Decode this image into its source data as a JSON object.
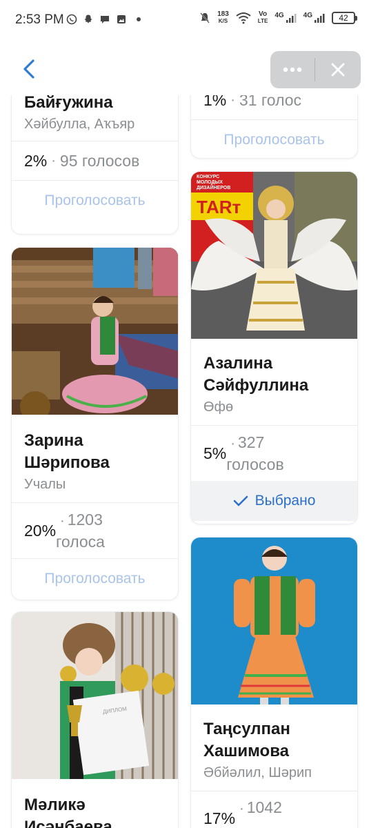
{
  "status": {
    "time": "2:53 PM",
    "net_speed_top": "183",
    "net_speed_bottom": "K/S",
    "volte_top": "Vo",
    "volte_bottom": "LTE",
    "sig1": "4G",
    "sig2": "4G",
    "battery": "42"
  },
  "header": {
    "more_icon": "more-dots-icon",
    "close_icon": "close-icon"
  },
  "cards": {
    "c1": {
      "name": "Байғужина",
      "city": "Хәйбулла, Аҡъяр",
      "pct": "2%",
      "votes": "95 голосов",
      "action": "Проголосовать"
    },
    "c2": {
      "pct": "1%",
      "votes": "31 голос",
      "action": "Проголосовать"
    },
    "c3": {
      "name_line1": "Зарина",
      "name_line2": "Шәрипова",
      "city": "Учалы",
      "pct": "20%",
      "votes_line1": "1203",
      "votes_line2": "голоса",
      "action": "Проголосовать"
    },
    "c4": {
      "banner_small1": "КОНКУРС",
      "banner_small2": "МОЛОДЫХ",
      "banner_small3": "ДИЗАЙНЕРОВ",
      "banner_big": "TARт",
      "name_line1": "Азалина",
      "name_line2": "Сәйфуллина",
      "city": "Өфө",
      "pct": "5%",
      "votes_line1": "327",
      "votes_line2": "голосов",
      "chosen": "Выбрано"
    },
    "c5": {
      "diploma": "ДИПЛОМ",
      "name_line1": "Мәликә",
      "name_line2": "Исәнбаева"
    },
    "c6": {
      "name_line1": "Таңсулпан",
      "name_line2": "Хашимова",
      "city": "Әбйәлил, Шәрип",
      "pct": "17%",
      "votes_line1": "1042"
    }
  },
  "separator": "·"
}
